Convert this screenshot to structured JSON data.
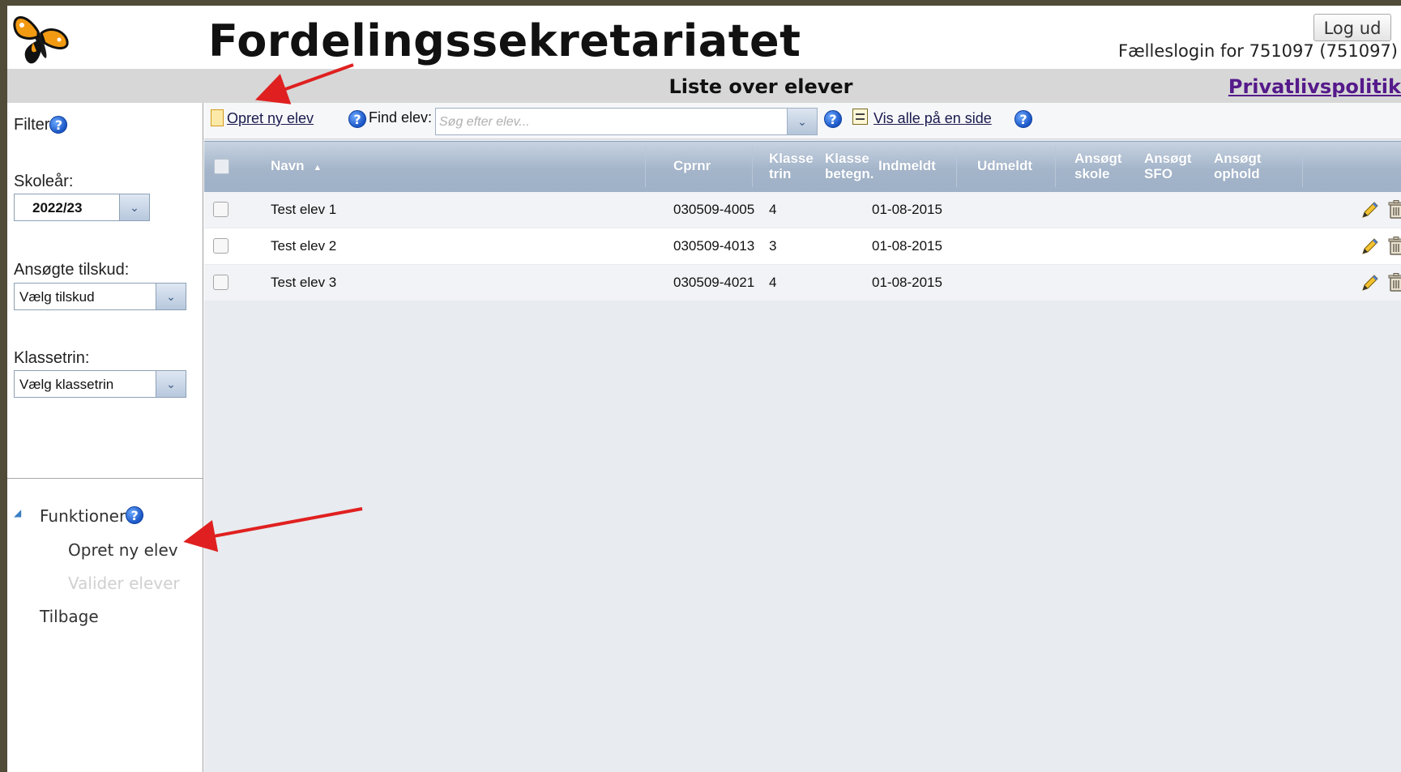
{
  "header": {
    "app_title": "Fordelingssekretariatet",
    "logout_label": "Log ud",
    "login_info": "Fælleslogin for 751097 (751097)",
    "subtitle": "Liste over elever",
    "privacy_link": "Privatlivspolitik"
  },
  "sidebar": {
    "filter_label": "Filter",
    "school_year_label": "Skoleår:",
    "school_year_value": "2022/23",
    "subsidy_label": "Ansøgte tilskud:",
    "subsidy_value": "Vælg tilskud",
    "grade_label": "Klassetrin:",
    "grade_value": "Vælg klassetrin",
    "functions_label": "Funktioner",
    "menu": {
      "create": "Opret ny elev",
      "validate": "Valider elever",
      "back": "Tilbage"
    }
  },
  "toolbar": {
    "create_label": "Opret ny elev",
    "find_label": "Find elev:",
    "search_placeholder": "Søg efter elev...",
    "show_all_label": "Vis alle på en side"
  },
  "table": {
    "columns": {
      "name": "Navn",
      "cpr": "Cprnr",
      "grade_trin_1": "Klasse",
      "grade_trin_2": "trin",
      "grade_betegn_1": "Klasse",
      "grade_betegn_2": "betegn.",
      "enrolled": "Indmeldt",
      "unenrolled": "Udmeldt",
      "applied_school_1": "Ansøgt",
      "applied_school_2": "skole",
      "applied_sfo_1": "Ansøgt",
      "applied_sfo_2": "SFO",
      "applied_stay_1": "Ansøgt",
      "applied_stay_2": "ophold"
    },
    "rows": [
      {
        "name": "Test elev 1",
        "cpr": "030509-4005",
        "grade": "4",
        "enrolled": "01-08-2015"
      },
      {
        "name": "Test elev 2",
        "cpr": "030509-4013",
        "grade": "3",
        "enrolled": "01-08-2015"
      },
      {
        "name": "Test elev 3",
        "cpr": "030509-4021",
        "grade": "4",
        "enrolled": "01-08-2015"
      }
    ]
  },
  "colors": {
    "frame_background": "#504c38",
    "header_gradient": "#a4b5ca",
    "privacy_link": "#551a8b",
    "annotation_arrow": "#e02020"
  }
}
